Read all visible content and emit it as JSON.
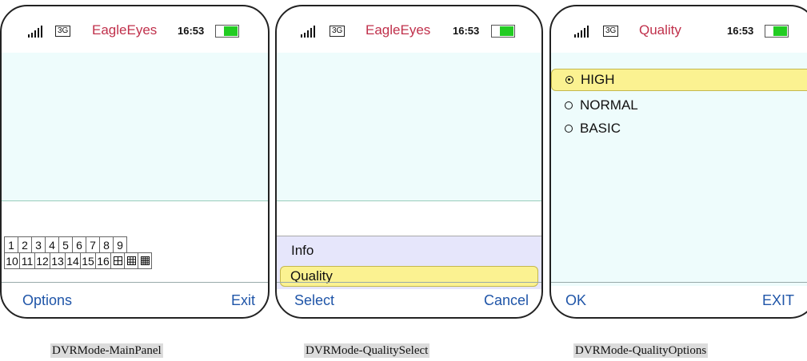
{
  "screens": [
    {
      "status": {
        "network": "3G",
        "title": "EagleEyes",
        "time": "16:53"
      },
      "grid": {
        "row1": [
          "1",
          "2",
          "3",
          "4",
          "5",
          "6",
          "7",
          "8",
          "9"
        ],
        "row2": [
          "10",
          "11",
          "12",
          "13",
          "14",
          "15",
          "16"
        ],
        "layout_icons": [
          "quad-layout-icon",
          "nine-layout-icon",
          "sixteen-layout-icon"
        ]
      },
      "softkeys": {
        "left": "Options",
        "right": "Exit"
      },
      "caption": "DVRMode-MainPanel"
    },
    {
      "status": {
        "network": "3G",
        "title": "EagleEyes",
        "time": "16:53"
      },
      "menu": {
        "items": [
          "Info",
          "Quality"
        ],
        "selected": "Quality"
      },
      "softkeys": {
        "left": "Select",
        "right": "Cancel"
      },
      "caption": "DVRMode-QualitySelect"
    },
    {
      "status": {
        "network": "3G",
        "title": "Quality",
        "time": "16:53"
      },
      "options": {
        "items": [
          "HIGH",
          "NORMAL",
          "BASIC"
        ],
        "selected": "HIGH"
      },
      "softkeys": {
        "left": "OK",
        "right": "EXIT"
      },
      "caption": "DVRMode-QualityOptions"
    }
  ],
  "colors": {
    "title": "#c0304b",
    "softkey": "#1f55a8",
    "highlight": "#fbf291",
    "battery": "#22cc22"
  }
}
